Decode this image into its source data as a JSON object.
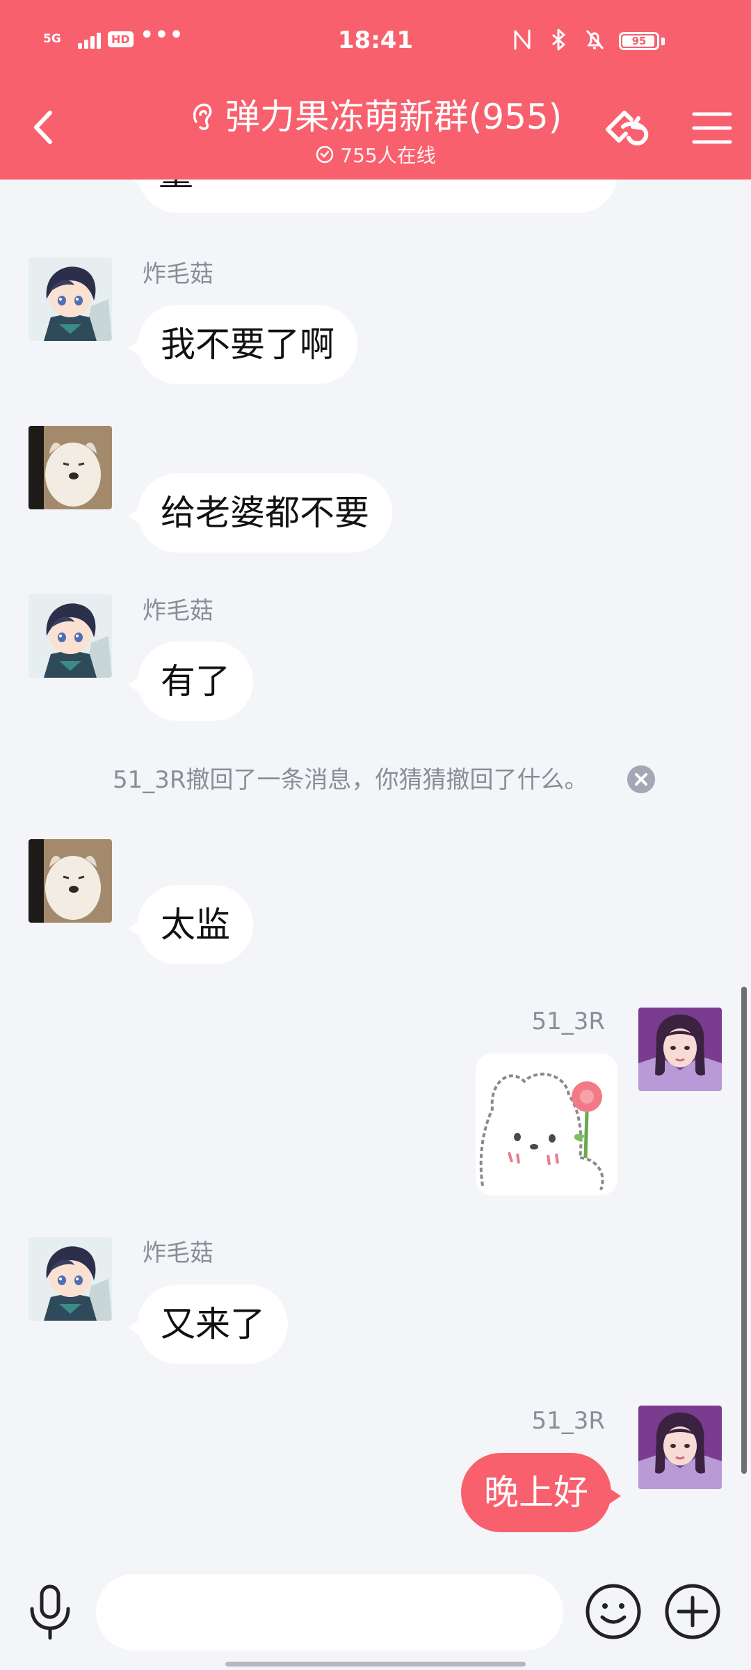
{
  "status_bar": {
    "network": "5G",
    "hd_badge": "HD",
    "more": "•••",
    "time": "18:41",
    "battery": "95",
    "battery_level": 0.95
  },
  "header": {
    "title": "弹力果冻萌新群(955)",
    "online": "755人在线",
    "icons": {
      "back": "back-chevron-icon",
      "ear": "ear-icon",
      "online": "online-check-icon",
      "link": "link-icon",
      "menu": "menu-icon"
    }
  },
  "colors": {
    "accent": "#f8606e",
    "background": "#f4f5f9",
    "bubble": "#ffffff",
    "muted_text": "#8a8d96"
  },
  "messages": [
    {
      "type": "left",
      "avatar": "anime-boy-avatar",
      "sender": "",
      "text": "量"
    },
    {
      "type": "left",
      "avatar": "anime-boy-avatar",
      "sender": "炸毛菇",
      "text": "我不要了啊"
    },
    {
      "type": "left",
      "avatar": "dog-avatar",
      "sender": "",
      "text": "给老婆都不要"
    },
    {
      "type": "left",
      "avatar": "anime-boy-avatar",
      "sender": "炸毛菇",
      "text": "有了"
    },
    {
      "type": "system",
      "text": "51_3R撤回了一条消息，你猜猜撤回了什么。"
    },
    {
      "type": "left",
      "avatar": "dog-avatar",
      "sender": "",
      "text": "太监"
    },
    {
      "type": "right",
      "avatar": "girl-avatar",
      "sender": "51_3R",
      "sticker": "bear-flower-sticker"
    },
    {
      "type": "left",
      "avatar": "anime-boy-avatar",
      "sender": "炸毛菇",
      "text": "又来了"
    },
    {
      "type": "right",
      "avatar": "girl-avatar",
      "sender": "51_3R",
      "text": "晚上好"
    }
  ],
  "input_bar": {
    "placeholder": "",
    "icons": {
      "voice": "microphone-icon",
      "emoji": "emoji-icon",
      "plus": "plus-icon"
    }
  }
}
